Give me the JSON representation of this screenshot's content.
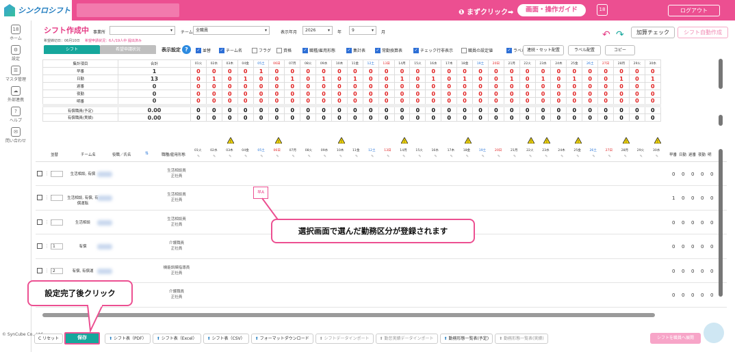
{
  "app": {
    "name": "シンクロシフト"
  },
  "header": {
    "first_click": "❶ まずクリック➡",
    "guide_button": "画面・操作ガイド",
    "calendar_icon_text": "18",
    "logout": "ログアウト"
  },
  "sidebar": {
    "items": [
      {
        "label": "ホーム",
        "icon": "calendar-icon",
        "glyph": "18"
      },
      {
        "label": "設定",
        "icon": "gear-icon",
        "glyph": "⚙"
      },
      {
        "label": "マスタ管理",
        "icon": "database-icon",
        "glyph": "☰"
      },
      {
        "label": "外部連携",
        "icon": "cloud-icon",
        "glyph": "☁"
      },
      {
        "label": "ヘルプ",
        "icon": "help-icon",
        "glyph": "?"
      },
      {
        "label": "問い合わせ",
        "icon": "mail-icon",
        "glyph": "✉"
      }
    ],
    "copyright": "© SynCube Co., Ltd."
  },
  "page": {
    "title": "シフト作成中",
    "office_label": "事業所",
    "team_label": "チーム",
    "team_value": "全職員",
    "month_label": "表示年月",
    "year_value": "2026",
    "year_unit": "年",
    "month_value": "9",
    "month_unit": "月",
    "deadline_note": "希望締切日：06月10日",
    "status_note": "希望申請状況：6人/19人中 提出済み",
    "tab_shift": "シフト",
    "tab_status": "希望申請状況",
    "display_settings": "表示設定",
    "check_button": "加算チェック",
    "auto_button": "シフト自動作成",
    "checkboxes": [
      {
        "label": "並替",
        "on": true
      },
      {
        "label": "チーム名",
        "on": true
      },
      {
        "label": "フラグ",
        "on": false
      },
      {
        "label": "資格",
        "on": false
      },
      {
        "label": "職種/雇用形態",
        "on": true
      },
      {
        "label": "集計表",
        "on": true
      },
      {
        "label": "常勤換算表",
        "on": true
      },
      {
        "label": "チェック行非表示",
        "on": true
      },
      {
        "label": "職員の設定値",
        "on": false
      },
      {
        "label": "ラベル欄",
        "on": true
      }
    ],
    "buttons": {
      "consecutive": "連続・セット配置",
      "label": "ラベル配置",
      "copy": "コピー"
    }
  },
  "summary": {
    "headers": {
      "item": "集計項目",
      "total": "合計"
    },
    "days": [
      "01火",
      "02水",
      "03木",
      "04金",
      "05土",
      "06日",
      "07月",
      "08火",
      "09水",
      "10木",
      "11金",
      "12土",
      "13日",
      "14月",
      "15火",
      "16水",
      "17木",
      "18金",
      "19土",
      "20日",
      "21月",
      "22火",
      "23水",
      "24木",
      "25金",
      "26土",
      "27日",
      "28月",
      "29火",
      "30水"
    ],
    "rows": [
      {
        "label": "早番",
        "total": "1",
        "vals": [
          "0",
          "0",
          "0",
          "0",
          "1",
          "0",
          "0",
          "0",
          "0",
          "0",
          "0",
          "0",
          "0",
          "0",
          "0",
          "0",
          "0",
          "0",
          "0",
          "0",
          "0",
          "0",
          "0",
          "0",
          "0",
          "0",
          "0",
          "0",
          "0",
          "0"
        ]
      },
      {
        "label": "日勤",
        "total": "13",
        "vals": [
          "0",
          "1",
          "0",
          "1",
          "0",
          "0",
          "1",
          "0",
          "1",
          "0",
          "1",
          "0",
          "0",
          "1",
          "0",
          "1",
          "0",
          "1",
          "0",
          "0",
          "1",
          "0",
          "1",
          "0",
          "1",
          "0",
          "0",
          "1",
          "0",
          "1"
        ]
      },
      {
        "label": "遅番",
        "total": "0",
        "vals": [
          "0",
          "0",
          "0",
          "0",
          "0",
          "0",
          "0",
          "0",
          "0",
          "0",
          "0",
          "0",
          "0",
          "0",
          "0",
          "0",
          "0",
          "0",
          "0",
          "0",
          "0",
          "0",
          "0",
          "0",
          "0",
          "0",
          "0",
          "0",
          "0",
          "0"
        ]
      },
      {
        "label": "夜勤",
        "total": "0",
        "vals": [
          "0",
          "0",
          "0",
          "0",
          "0",
          "0",
          "0",
          "0",
          "0",
          "0",
          "0",
          "0",
          "0",
          "0",
          "0",
          "0",
          "0",
          "0",
          "0",
          "0",
          "0",
          "0",
          "0",
          "0",
          "0",
          "0",
          "0",
          "0",
          "0",
          "0"
        ]
      },
      {
        "label": "明番",
        "total": "0",
        "vals": [
          "0",
          "0",
          "0",
          "0",
          "0",
          "0",
          "0",
          "0",
          "0",
          "0",
          "0",
          "0",
          "0",
          "0",
          "0",
          "0",
          "0",
          "0",
          "0",
          "0",
          "0",
          "0",
          "0",
          "0",
          "0",
          "0",
          "0",
          "0",
          "0",
          "0"
        ]
      },
      {
        "label": "有償職員(予定)",
        "total": "0.00",
        "vals": [
          "0",
          "0",
          "0",
          "0",
          "0",
          "0",
          "0",
          "0",
          "0",
          "0",
          "0",
          "0",
          "0",
          "0",
          "0",
          "0",
          "0",
          "0",
          "0",
          "0",
          "0",
          "0",
          "0",
          "0",
          "0",
          "0",
          "0",
          "0",
          "0",
          "0"
        ]
      },
      {
        "label": "有償職員(実績)",
        "total": "0.00",
        "vals": [
          "0",
          "0",
          "0",
          "0",
          "0",
          "0",
          "0",
          "0",
          "0",
          "0",
          "0",
          "0",
          "0",
          "0",
          "0",
          "0",
          "0",
          "0",
          "0",
          "0",
          "0",
          "0",
          "0",
          "0",
          "0",
          "0",
          "0",
          "0",
          "0",
          "0"
        ]
      }
    ]
  },
  "main": {
    "headers": {
      "sort": "並替",
      "team": "チーム名",
      "name": "役職／氏名",
      "job": "職種/雇用形態",
      "counts": [
        "早番",
        "日勤",
        "遅番",
        "夜勤",
        "明"
      ]
    },
    "employees": [
      {
        "team": "生活相談, 有償",
        "job1": "生活相談員",
        "job2": "正社員",
        "num": "",
        "counts": [
          "0",
          "0",
          "0",
          "0",
          "0"
        ]
      },
      {
        "team": "生活相談, 有償, 有償運転",
        "job1": "生活相談員",
        "job2": "正社員",
        "num": "",
        "counts": [
          "1",
          "0",
          "0",
          "0",
          "0"
        ]
      },
      {
        "team": "生活相談",
        "job1": "生活相談員",
        "job2": "正社員",
        "num": "",
        "counts": [
          "0",
          "0",
          "0",
          "0",
          "0"
        ]
      },
      {
        "team": "有償",
        "job1": "介護職員",
        "job2": "正社員",
        "num": "1",
        "counts": [
          "0",
          "0",
          "0",
          "0",
          "0"
        ]
      },
      {
        "team": "有償, 有償運",
        "job1": "機能訓練指導員",
        "job2": "正社員",
        "num": "2",
        "counts": [
          "0",
          "0",
          "0",
          "0",
          "0"
        ]
      },
      {
        "team": "",
        "job1": "介護職員",
        "job2": "正社員",
        "num": "",
        "counts": [
          "0",
          "0",
          "0",
          "0",
          "0"
        ]
      }
    ],
    "shift_cell": "早A",
    "callout": "選択画面で選んだ勤務区分が登録されます",
    "callout_save": "設定完了後クリック"
  },
  "footer": {
    "reset": "C リセット",
    "save": "保存",
    "pdf": "シフト表（PDF）",
    "excel": "シフト表（Excel）",
    "csv": "シフト表（CSV）",
    "format_dl": "フォーマットダウンロード",
    "import": "シフトデータインポート",
    "attendance": "勤怠実績データインポート",
    "pattern_plan": "勤務形態一覧表(予定)",
    "pattern_actual": "勤務形態一覧表(実績)",
    "send": "シフトを職員へ展開"
  }
}
